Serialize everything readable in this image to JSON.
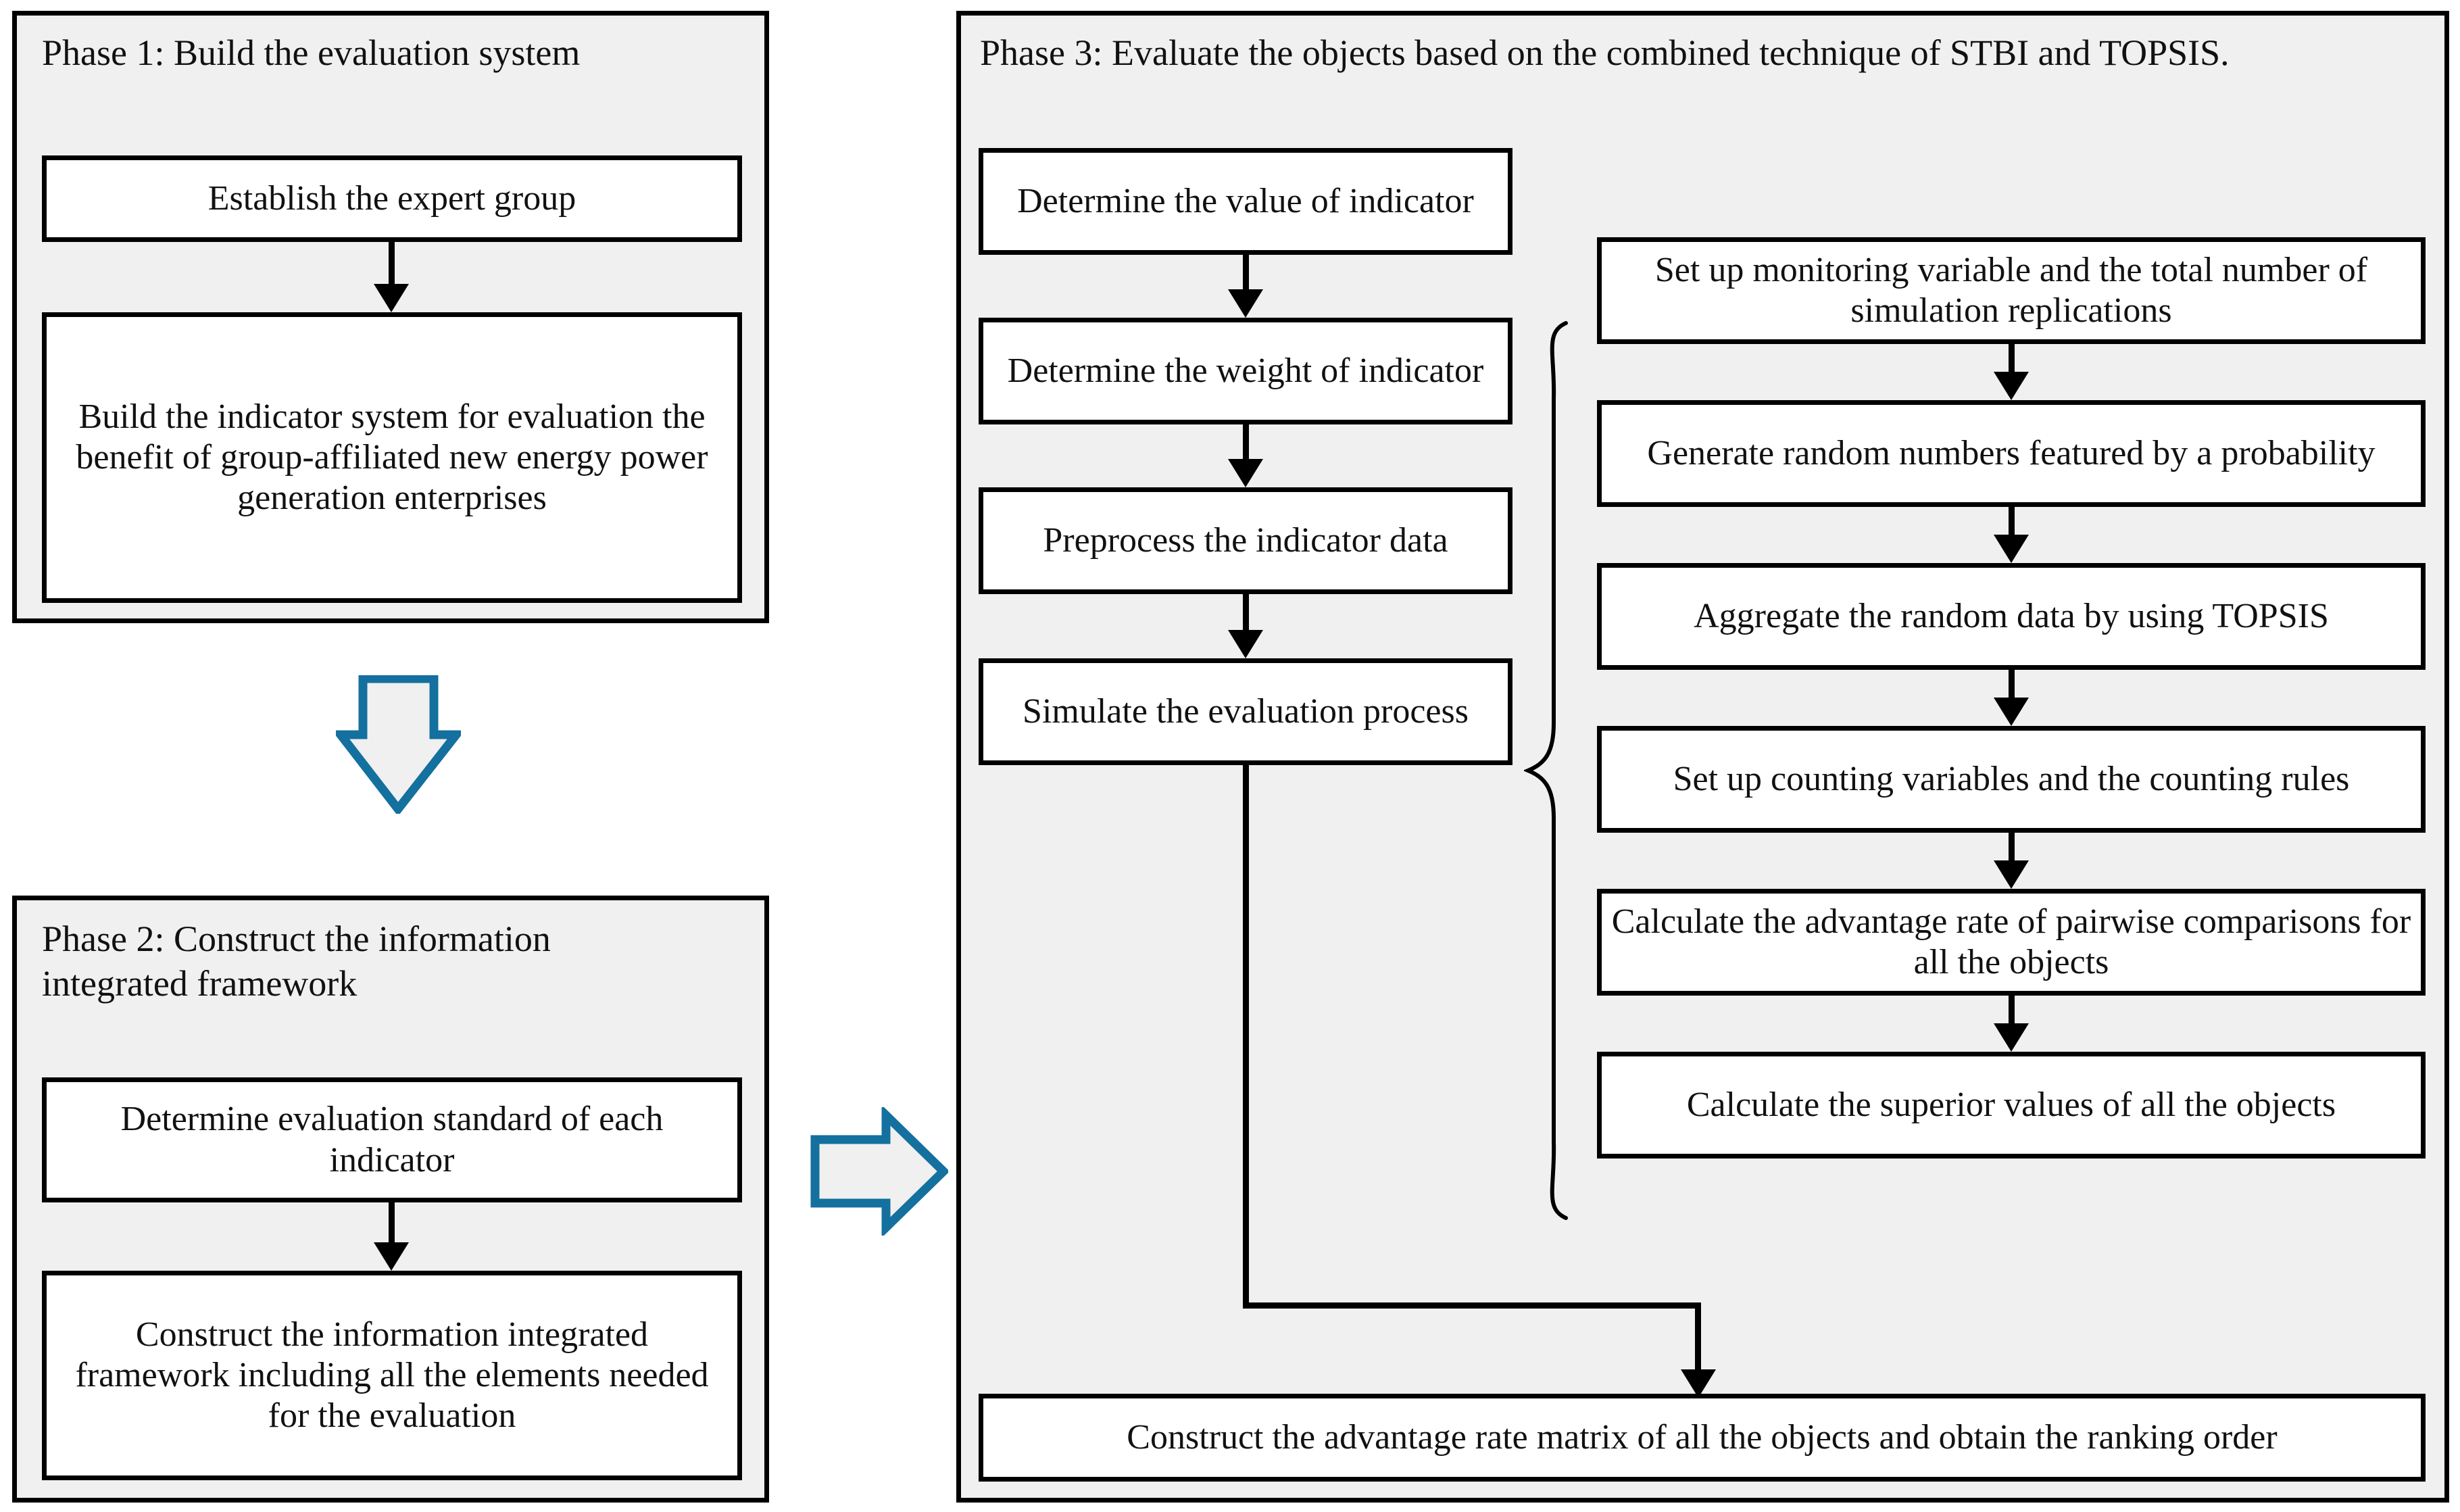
{
  "diagram": {
    "title": "Three-phase evaluation framework flowchart",
    "colors": {
      "phase_fill": "#f0f0f0",
      "node_fill": "#ffffff",
      "stroke": "#000000",
      "blue_arrow_stroke": "#14709e",
      "blue_arrow_fill": "#f0f0f0"
    }
  },
  "phase1": {
    "title": "Phase 1: Build the evaluation system",
    "nodes": [
      {
        "label": "Establish the expert group"
      },
      {
        "label": "Build the indicator system for evaluation the benefit of group-affiliated new energy power generation enterprises"
      }
    ]
  },
  "phase2": {
    "title": "Phase 2: Construct the information integrated framework",
    "nodes": [
      {
        "label": "Determine evaluation standard of each indicator"
      },
      {
        "label": "Construct the information integrated framework including all the elements needed for the evaluation"
      }
    ]
  },
  "phase3": {
    "title": "Phase 3: Evaluate the objects based on the combined technique of STBI and TOPSIS.",
    "left_nodes": [
      {
        "label": "Determine the value of indicator"
      },
      {
        "label": "Determine the weight of indicator"
      },
      {
        "label": "Preprocess the indicator data"
      },
      {
        "label": "Simulate the evaluation process"
      }
    ],
    "right_nodes": [
      {
        "label": "Set up monitoring variable and the total number of simulation replications"
      },
      {
        "label": "Generate random numbers featured by a probability"
      },
      {
        "label": "Aggregate the random data by using TOPSIS"
      },
      {
        "label": "Set up counting variables and the counting rules"
      },
      {
        "label": "Calculate the advantage rate of pairwise comparisons for all the objects"
      },
      {
        "label": "Calculate the superior values of  all the objects"
      }
    ],
    "bottom_node": {
      "label": "Construct the advantage rate matrix of all the objects and obtain the ranking order"
    }
  },
  "connectors": {
    "phase1_to_phase2": "down-block-arrow",
    "phase2_to_phase3": "right-block-arrow",
    "expansion_brace": "left-curly-brace"
  }
}
